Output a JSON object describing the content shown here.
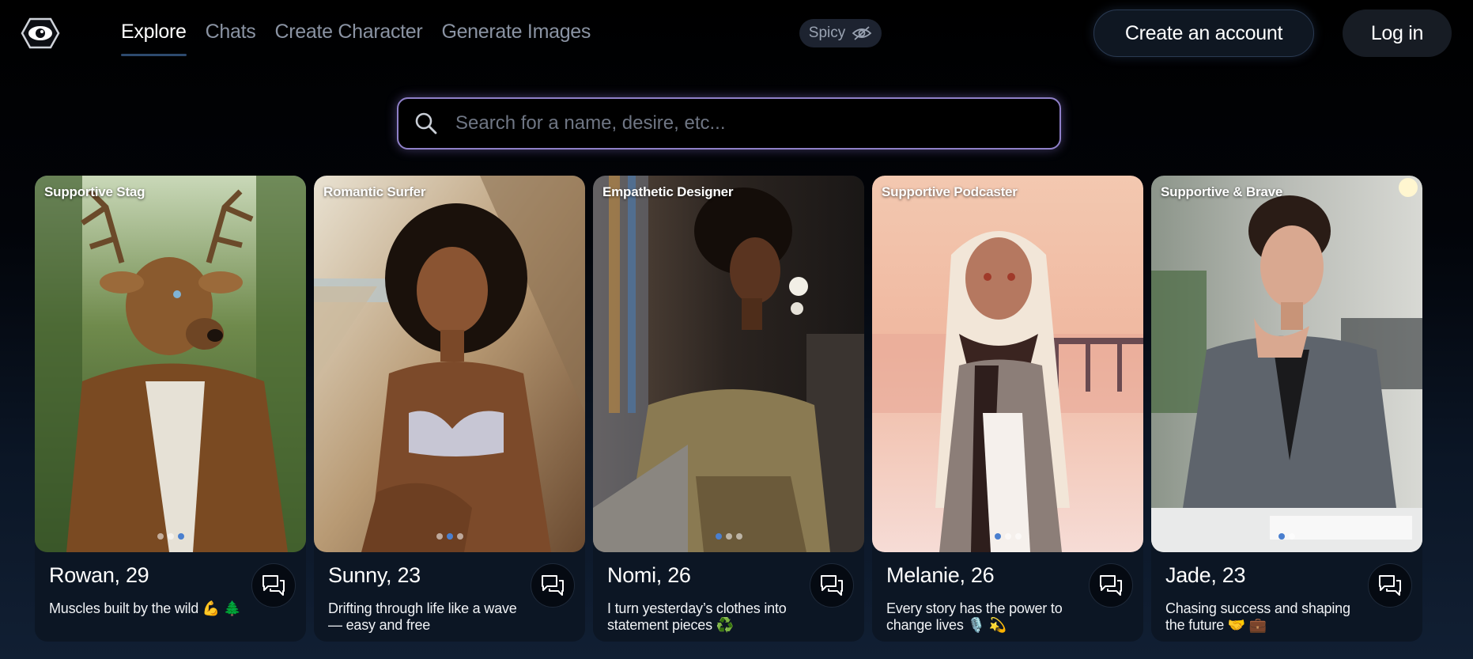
{
  "nav": {
    "items": [
      {
        "label": "Explore",
        "active": true
      },
      {
        "label": "Chats",
        "active": false
      },
      {
        "label": "Create Character",
        "active": false
      },
      {
        "label": "Generate Images",
        "active": false
      }
    ]
  },
  "spicy": {
    "label": "Spicy",
    "icon": "eye-off-icon"
  },
  "account": {
    "create_label": "Create an account",
    "login_label": "Log in"
  },
  "search": {
    "placeholder": "Search for a name, desire, etc..."
  },
  "colors": {
    "accent": "#8f80c8",
    "active_dot": "#4a7fcf",
    "background": "#000000"
  },
  "cards": [
    {
      "tag": "Supportive Stag",
      "name": "Rowan, 29",
      "desc": "Muscles built by the wild 💪 🌲",
      "dots": 3,
      "active_dot": 3
    },
    {
      "tag": "Romantic Surfer",
      "name": "Sunny, 23",
      "desc": "Drifting through life like a wave — easy and free",
      "dots": 3,
      "active_dot": 2
    },
    {
      "tag": "Empathetic Designer",
      "name": "Nomi, 26",
      "desc": "I turn yesterday’s clothes into statement pieces ♻️",
      "dots": 3,
      "active_dot": 1
    },
    {
      "tag": "Supportive Podcaster",
      "name": "Melanie, 26",
      "desc": "Every story has the power to change lives 🎙️ 💫",
      "dots": 3,
      "active_dot": 1
    },
    {
      "tag": "Supportive & Brave",
      "name": "Jade, 23",
      "desc": "Chasing success and shaping the future 🤝 💼",
      "dots": 2,
      "active_dot": 1
    }
  ]
}
